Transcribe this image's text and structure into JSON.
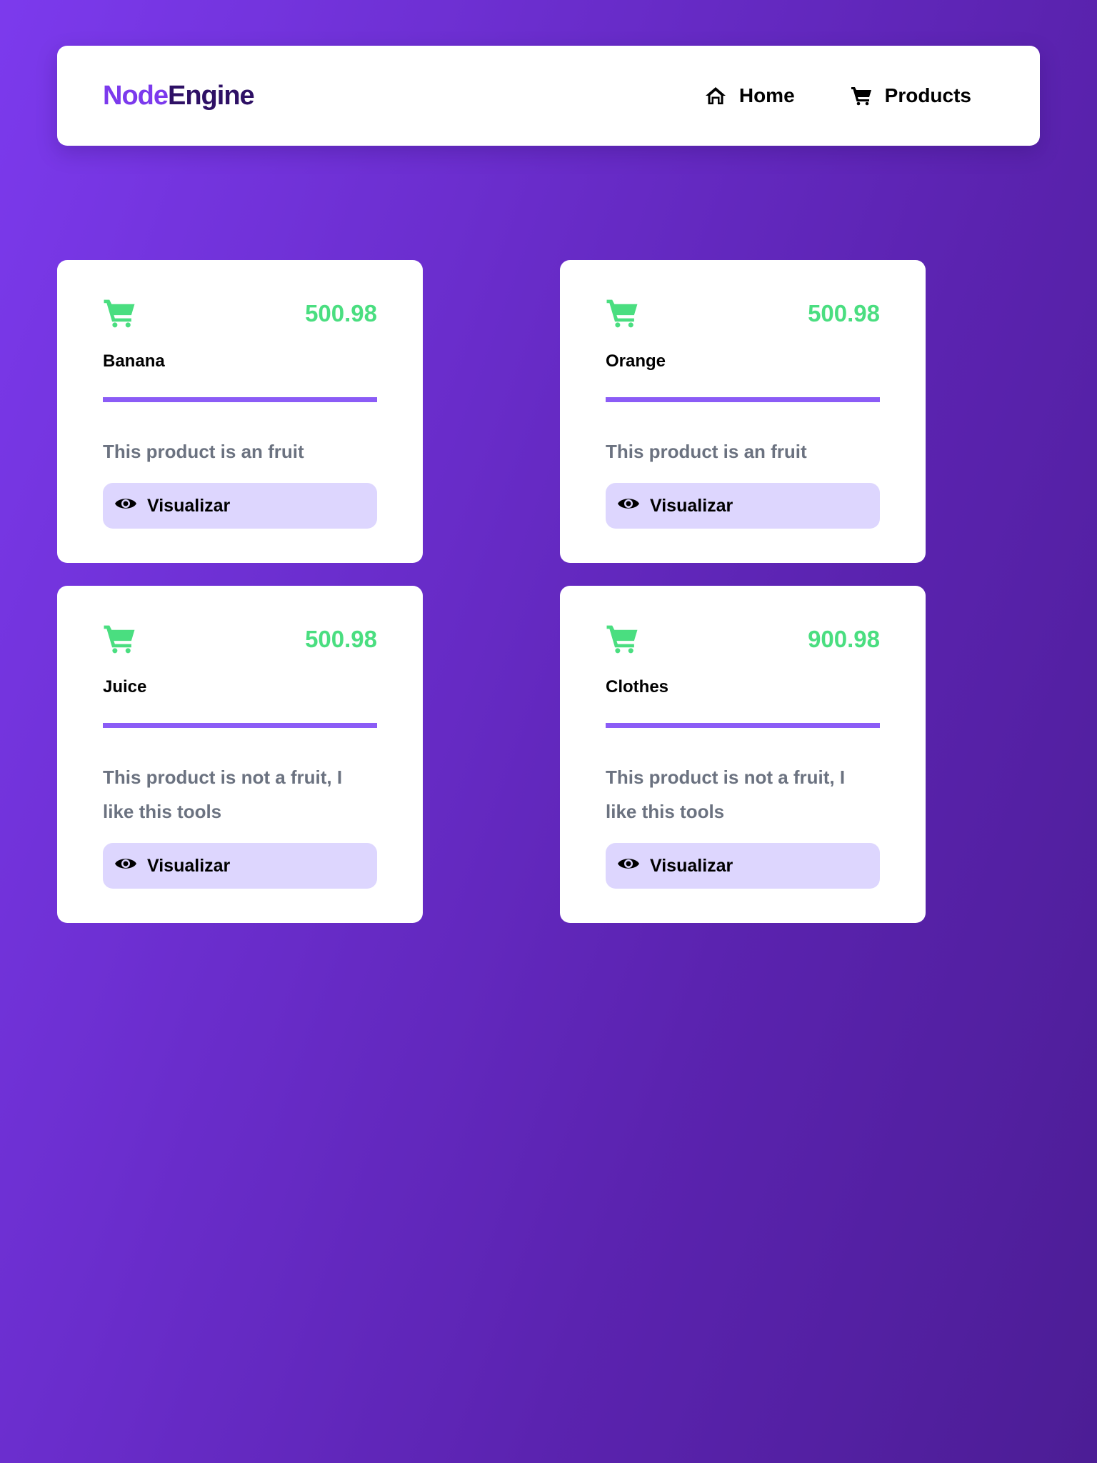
{
  "header": {
    "brand_part1": "Node",
    "brand_part2": "Engine",
    "nav": [
      {
        "label": "Home",
        "icon": "home-icon"
      },
      {
        "label": "Products",
        "icon": "cart-icon"
      }
    ]
  },
  "colors": {
    "accent": "#7c3aed",
    "brand_dark": "#2e1065",
    "price_green": "#4ade80",
    "divider": "#8b5cf6",
    "button_bg": "#ddd6fe",
    "description_text": "#6b7280"
  },
  "products": [
    {
      "name": "Banana",
      "price": "500.98",
      "description": "This product is an fruit",
      "button_label": "Visualizar",
      "icon": "cart-icon",
      "button_icon": "eye-icon"
    },
    {
      "name": "Orange",
      "price": "500.98",
      "description": "This product is an fruit",
      "button_label": "Visualizar",
      "icon": "cart-icon",
      "button_icon": "eye-icon"
    },
    {
      "name": "Juice",
      "price": "500.98",
      "description": "This product is not a fruit, I like this tools",
      "button_label": "Visualizar",
      "icon": "cart-icon",
      "button_icon": "eye-icon"
    },
    {
      "name": "Clothes",
      "price": "900.98",
      "description": "This product is not a fruit, I like this tools",
      "button_label": "Visualizar",
      "icon": "cart-icon",
      "button_icon": "eye-icon"
    }
  ]
}
